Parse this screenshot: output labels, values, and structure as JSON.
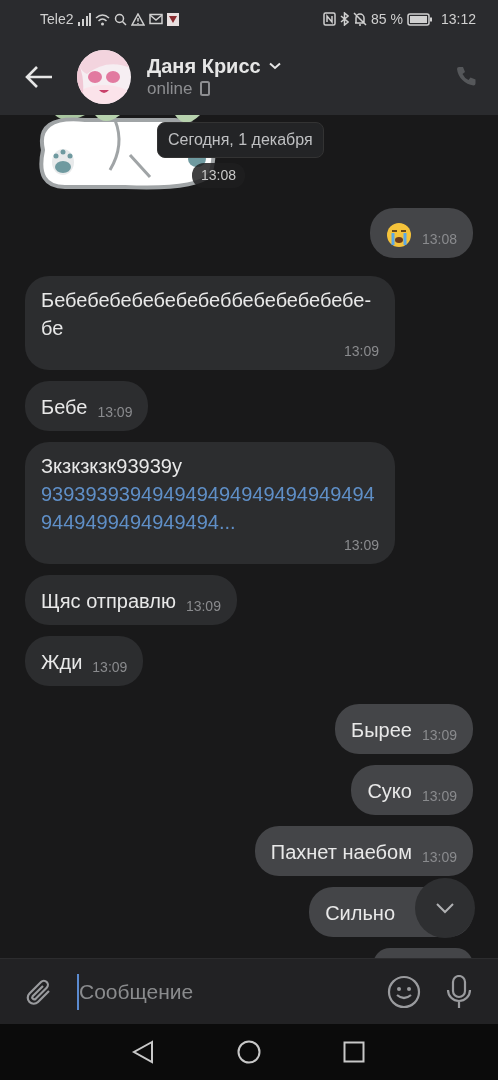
{
  "status_bar": {
    "carrier": "Tele2",
    "battery_percent": "85 %",
    "time": "13:12"
  },
  "header": {
    "name": "Даня Крисс",
    "status": "online"
  },
  "date_label": "Сегодня, 1 декабря",
  "messages": [
    {
      "kind": "sticker",
      "outgoing": false,
      "time": "13:08"
    },
    {
      "kind": "emoji",
      "outgoing": true,
      "time": "13:08"
    },
    {
      "kind": "text",
      "outgoing": false,
      "text": "Бебебебебебебебеббебебебебебе-бе",
      "time": "13:09"
    },
    {
      "kind": "text",
      "outgoing": false,
      "text": "Бебе",
      "time": "13:09"
    },
    {
      "kind": "link",
      "outgoing": false,
      "text": "Зкзкзкзк93939у",
      "link": "9393939394949494949494949494949449499494949494...",
      "time": "13:09"
    },
    {
      "kind": "text",
      "outgoing": false,
      "text": "Щяс отправлю",
      "time": "13:09"
    },
    {
      "kind": "text",
      "outgoing": false,
      "text": "Жди",
      "time": "13:09"
    },
    {
      "kind": "text",
      "outgoing": true,
      "text": "Бырее",
      "time": "13:09"
    },
    {
      "kind": "text",
      "outgoing": true,
      "text": "Суко",
      "time": "13:09"
    },
    {
      "kind": "text",
      "outgoing": true,
      "text": "Пахнет наебом",
      "time": "13:09"
    },
    {
      "kind": "text",
      "outgoing": true,
      "text": "Сильно"
    },
    {
      "kind": "cut",
      "outgoing": true
    }
  ],
  "composer": {
    "placeholder": "Сообщение"
  }
}
